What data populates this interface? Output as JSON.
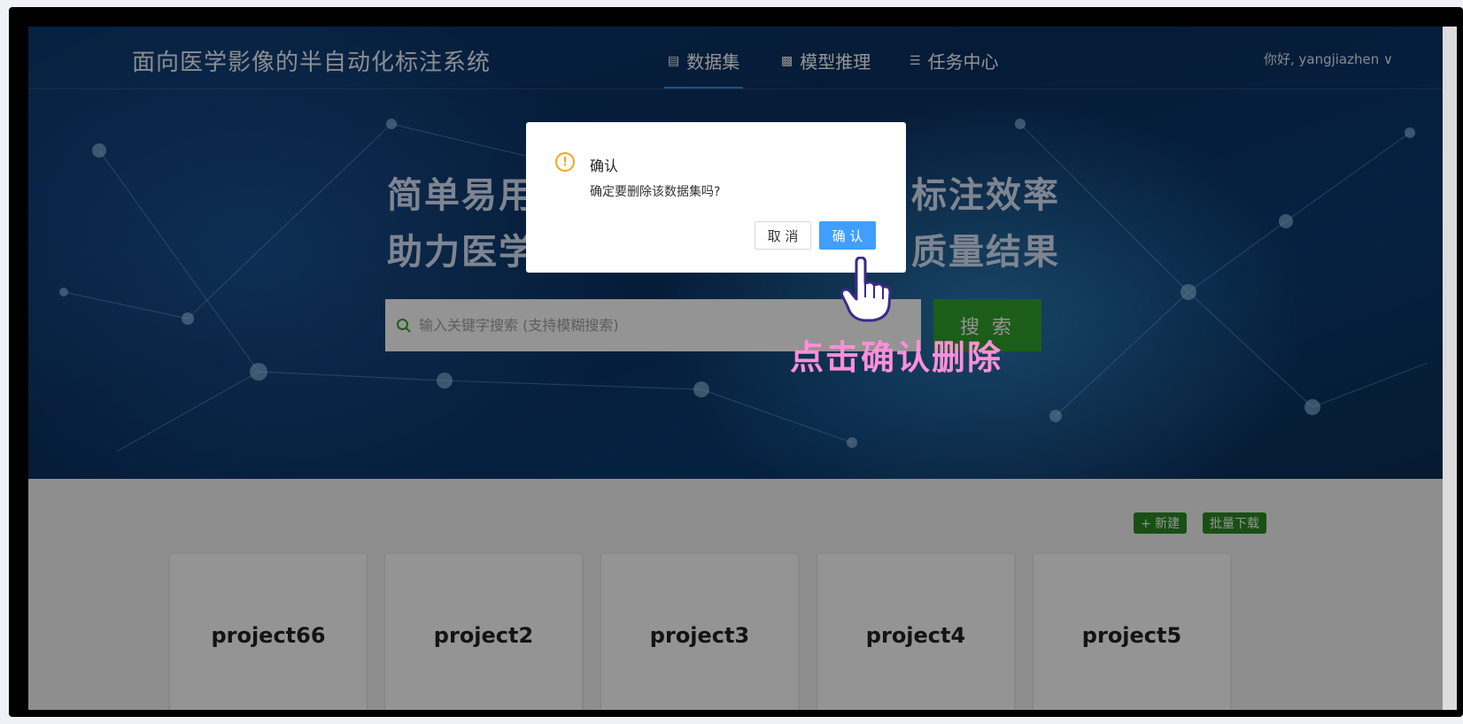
{
  "app": {
    "title": "面向医学影像的半自动化标注系统",
    "nav": [
      {
        "label": "数据集",
        "icon": "list-icon"
      },
      {
        "label": "模型推理",
        "icon": "chart-icon"
      },
      {
        "label": "任务中心",
        "icon": "menu-icon"
      }
    ],
    "user": "你好, yangjiazhen ∨"
  },
  "hero": {
    "slogan_line1_left": "简单易用",
    "slogan_line1_right": "标注效率",
    "slogan_line2_left": "助力医学",
    "slogan_line2_right": "质量结果",
    "search_placeholder": "输入关键字搜索 (支持模糊搜索)",
    "search_button": "搜 索"
  },
  "toolbar": {
    "new_label": "+ 新建",
    "batch_download_label": "批量下载"
  },
  "projects": [
    "project66",
    "project2",
    "project3",
    "project4",
    "project5"
  ],
  "dialog": {
    "title": "确认",
    "message": "确定要删除该数据集吗?",
    "cancel_label": "取 消",
    "confirm_label": "确 认"
  },
  "annotation": "点击确认删除",
  "colors": {
    "accent": "#409eff",
    "search_green": "#2fa12b",
    "toolbar_green": "#2a8a22",
    "warning": "#f5a623",
    "annotation_pink": "#ff8fd8"
  }
}
